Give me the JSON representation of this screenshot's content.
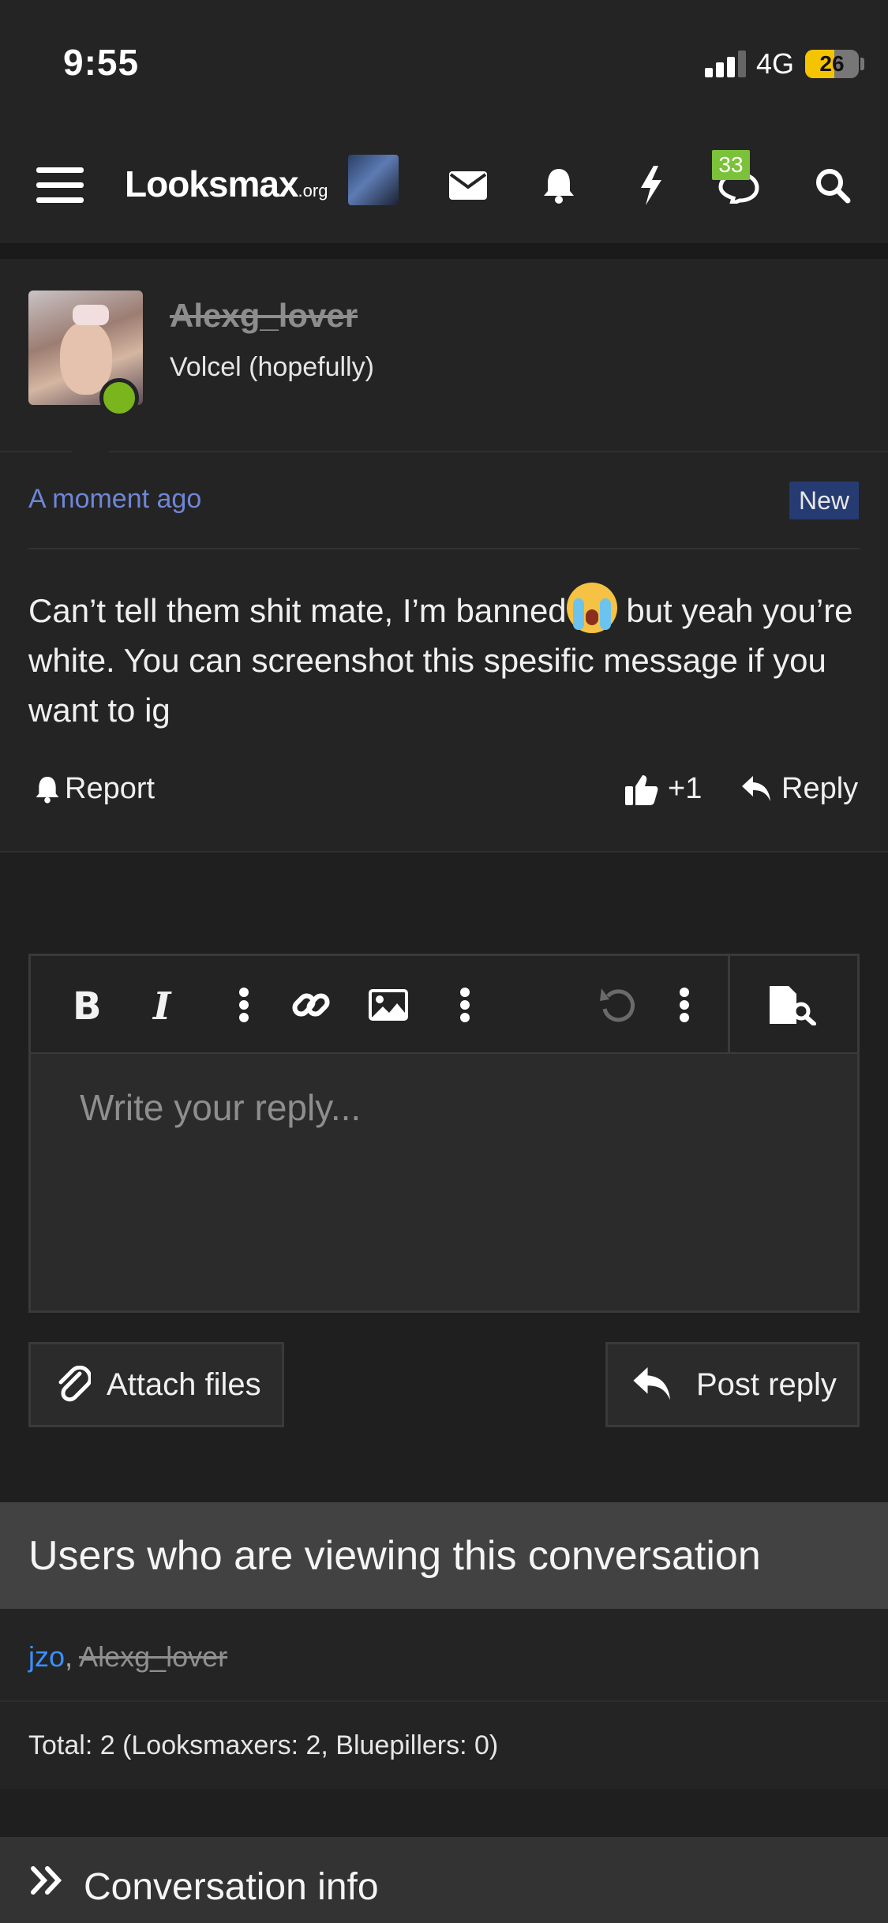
{
  "status_bar": {
    "time": "9:55",
    "network": "4G",
    "battery_level": "26",
    "battery_color": "#f5c400"
  },
  "nav": {
    "logo_main": "Looksmax",
    "logo_suffix": ".org",
    "conversations_badge": "33",
    "icons": [
      "menu-icon",
      "avatar",
      "envelope-icon",
      "bell-icon",
      "bolt-icon",
      "chat-icon",
      "search-icon"
    ]
  },
  "post": {
    "username": "Alexg_lover",
    "user_title": "Volcel (hopefully)",
    "time": "A moment ago",
    "new_badge": "New",
    "message_part1": "Can’t tell them shit mate, I’m banned",
    "message_part2": " but yeah you’re white. You can screenshot this spesific message if you want to ig",
    "report_label": "Report",
    "like_count": "+1",
    "reply_label": "Reply"
  },
  "editor": {
    "placeholder": "Write your reply...",
    "toolbar_icons": [
      "bold-icon",
      "italic-icon",
      "more-vertical-icon",
      "link-icon",
      "image-icon",
      "more-vertical-icon",
      "undo-icon",
      "more-vertical-icon",
      "preview-icon"
    ],
    "attach_label": "Attach files",
    "post_reply_label": "Post reply"
  },
  "viewers": {
    "heading": "Users who are viewing this conversation",
    "user1": "jzo",
    "separator": ", ",
    "user2": "Alexg_lover",
    "total": "Total: 2 (Looksmaxers: 2, Bluepillers: 0)"
  },
  "conversation_info": {
    "label": "Conversation info"
  },
  "colors": {
    "accent_link": "#3a90ff",
    "online": "#7ab51d",
    "badge_green": "#7bc13a",
    "new_badge_bg": "#253b72",
    "time_link": "#6f86d6"
  }
}
